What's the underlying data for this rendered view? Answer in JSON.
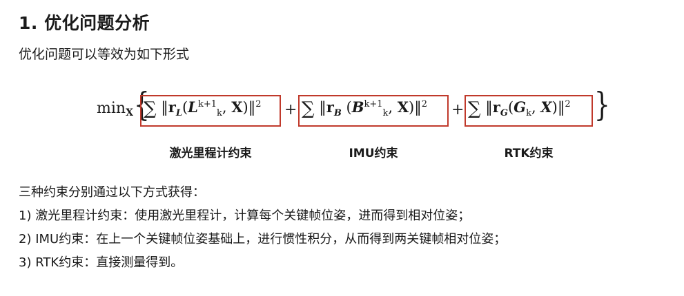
{
  "heading": "1. 优化问题分析",
  "intro": "优化问题可以等效为如下形式",
  "formula": {
    "min": "min",
    "min_sub": "X",
    "term1": {
      "r_sub": "L",
      "arg1": "L",
      "arg1_sup": "k+1",
      "arg1_sub": "k",
      "arg2": "X",
      "caption": "激光里程计约束"
    },
    "term2": {
      "r_sub": "B",
      "arg1": "B",
      "arg1_sup": "k+1",
      "arg1_sub": "k",
      "arg2": "X",
      "caption": "IMU约束"
    },
    "term3": {
      "r_sub": "G",
      "arg1": "G",
      "arg1_sub": "k",
      "arg2": "X",
      "caption": "RTK约束"
    },
    "box_color": "#c0392b"
  },
  "lines": [
    "三种约束分别通过以下方式获得：",
    "1) 激光里程计约束：使用激光里程计，计算每个关键帧位姿，进而得到相对位姿；",
    "2) IMU约束：在上一个关键帧位姿基础上，进行惯性积分，从而得到两关键帧相对位姿；",
    "3) RTK约束：直接测量得到。"
  ]
}
